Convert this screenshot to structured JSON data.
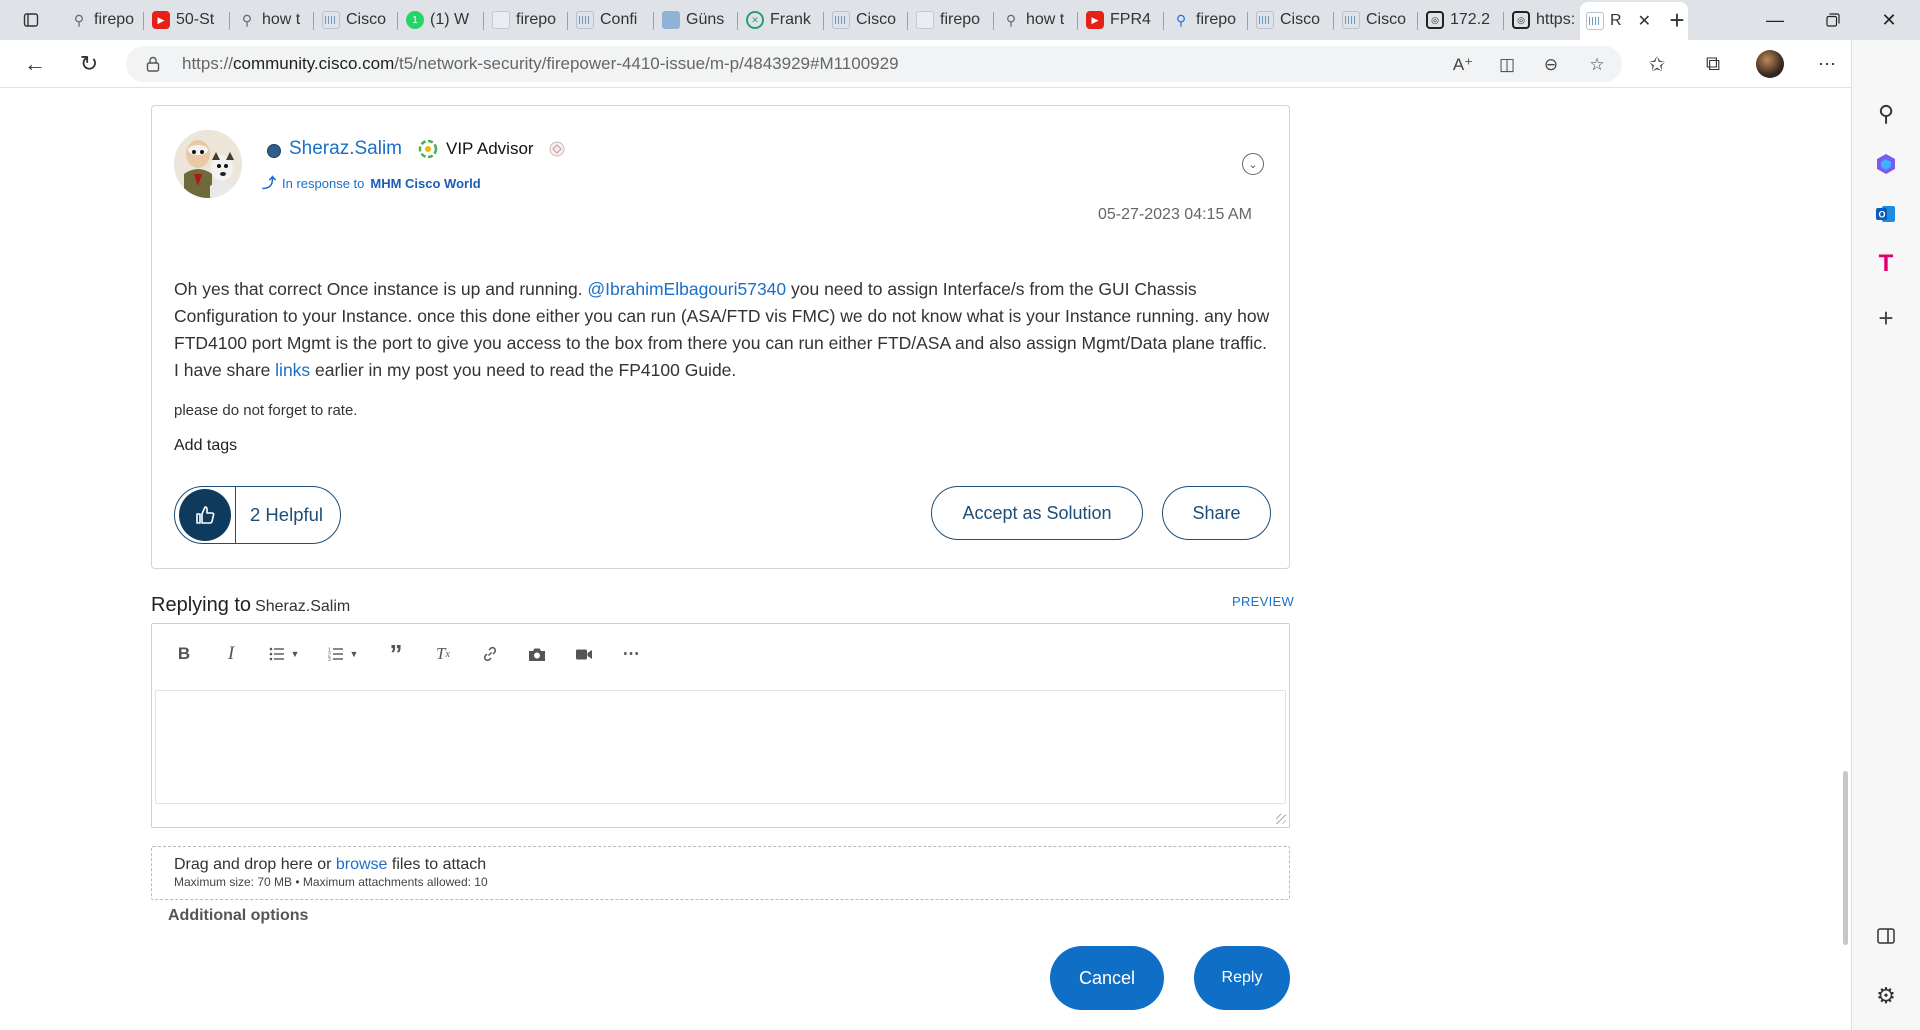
{
  "browser": {
    "tabs": [
      {
        "favicon": "search-icon",
        "title": "firepo"
      },
      {
        "favicon": "youtube-icon",
        "title": "50-St"
      },
      {
        "favicon": "search-icon",
        "title": "how t"
      },
      {
        "favicon": "cisco-icon",
        "title": "Cisco"
      },
      {
        "favicon": "whatsapp-icon",
        "title": "(1) W"
      },
      {
        "favicon": "doc-icon",
        "title": "firepo"
      },
      {
        "favicon": "cisco-icon",
        "title": "Confi"
      },
      {
        "favicon": "chart-icon",
        "title": "Güns"
      },
      {
        "favicon": "ring-icon",
        "title": "Frank"
      },
      {
        "favicon": "cisco-icon",
        "title": "Cisco"
      },
      {
        "favicon": "doc-icon",
        "title": "firepo"
      },
      {
        "favicon": "search-icon",
        "title": "how t"
      },
      {
        "favicon": "youtube-icon",
        "title": "FPR4"
      },
      {
        "favicon": "search-icon",
        "title": "firepo"
      },
      {
        "favicon": "cisco-icon",
        "title": "Cisco"
      },
      {
        "favicon": "cisco-icon",
        "title": "Cisco"
      },
      {
        "favicon": "page-icon",
        "title": "172.2"
      },
      {
        "favicon": "page-icon",
        "title": "https:"
      },
      {
        "favicon": "cisco-icon",
        "title": "R"
      }
    ],
    "url_scheme": "https://",
    "url_host": "community.cisco.com",
    "url_path": "/t5/network-security/firepower-4410-issue/m-p/4843929#M1100929"
  },
  "post": {
    "author": "Sheraz.Salim",
    "rank": "VIP Advisor",
    "in_response_prefix": "In response to",
    "in_response_user": "MHM Cisco World",
    "date": "05-27-2023",
    "time": "04:15 AM",
    "body_part1": "Oh yes that correct Once instance is up and running. ",
    "mention": "@IbrahimElbagouri57340",
    "body_part2": " you need to assign Interface/s from the  GUI Chassis Configuration to your Instance. once this done either you can run (ASA/FTD vis FMC) we do not know what is your Instance running. any how FTD4100 port Mgmt is the port to give you access to the box from there you can run either FTD/ASA and also assign Mgmt/Data plane traffic. I have share ",
    "body_link": "links",
    "body_part3": " earlier in my post you need to read the FP4100 Guide.",
    "rate_note": "please do not forget to rate.",
    "add_tags": "Add tags",
    "helpful": "2 Helpful",
    "accept_solution": "Accept as Solution",
    "share": "Share"
  },
  "reply": {
    "heading": "Replying to",
    "heading_user": "Sheraz.Salim",
    "preview": "PREVIEW",
    "toolbar": [
      "bold",
      "italic",
      "bulleted-list",
      "numbered-list",
      "quote",
      "clear-format",
      "link",
      "camera",
      "video",
      "more"
    ],
    "drop_prefix": "Drag and drop here or ",
    "drop_browse": "browse",
    "drop_suffix": " files to attach",
    "drop_limits": "Maximum size: 70 MB • Maximum attachments allowed: 10",
    "additional_options": "Additional options",
    "cancel": "Cancel",
    "submit": "Reply"
  },
  "colors": {
    "link_blue": "#1a6fc9",
    "button_blue": "#0f6fc6",
    "navy": "#1e4d77"
  }
}
